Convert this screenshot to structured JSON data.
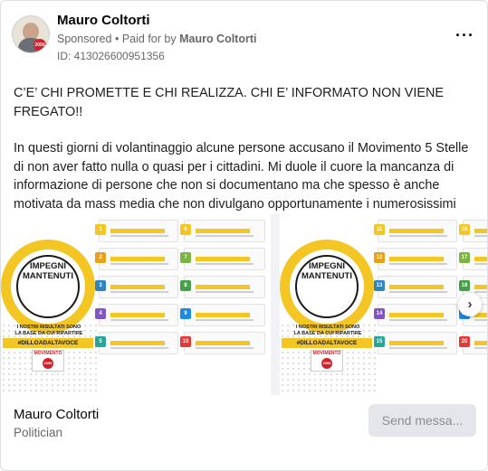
{
  "header": {
    "page_name": "Mauro Coltorti",
    "sponsored_label": "Sponsored",
    "separator": "•",
    "paid_for_prefix": "Paid for by",
    "paid_for_name": "Mauro Coltorti",
    "library_id": "ID: 413026600951356",
    "more_icon": "more-horizontal-icon",
    "avatar_badge": "2050"
  },
  "post": {
    "headline": "C’E’ CHI PROMETTE E CHI REALIZZA. CHI E’ INFORMATO NON VIENE FREGATO!!",
    "paragraph": "In questi giorni di volantinaggio alcune persone accusano il Movimento 5 Stelle di non aver fatto nulla o quasi per i cittadini. Mi duole il cuore la mancanza di informazione di persone che non si documentano ma che spesso è anche motivata da mass media che non divulgano opportunamente i numerosissimi provvedimenti utili al paese. Abbiamo avuto una delle legislature più complesse…"
  },
  "carousel": {
    "slides": [
      {
        "ring_title": "IMPEGNI\nMANTENUTI",
        "subtitle": "I NOSTRI RISULTATI SONO\nLA BASE DA CUI RIPARTIRE",
        "hashtag": "#DILLOADALTAVOCE",
        "logo_text": "MOVIMENTO",
        "logo_year": "2050",
        "numbers_left": [
          "1",
          "2",
          "3",
          "4",
          "5"
        ],
        "numbers_right": [
          "6",
          "7",
          "8",
          "9",
          "10"
        ]
      },
      {
        "ring_title": "IMPEGNI\nMANTENUTI",
        "subtitle": "I NOSTRI RISULTATI SONO\nLA BASE DA CUI RIPARTIRE",
        "hashtag": "#DILLOADALTAVOCE",
        "logo_text": "MOVIMENTO",
        "logo_year": "2050",
        "numbers_left": [
          "11",
          "12",
          "13",
          "14",
          "15"
        ],
        "numbers_right": [
          "16",
          "17",
          "18",
          "19",
          "20"
        ]
      }
    ],
    "next_icon": "chevron-right-icon",
    "next_glyph": "›",
    "row_colors": [
      "#f3c623",
      "#e8a21a",
      "#2e86c1",
      "#7e57c2",
      "#26a69a"
    ],
    "row_colors_right": [
      "#f3c623",
      "#7cb342",
      "#43a047",
      "#1e88e5",
      "#e53935"
    ]
  },
  "footer": {
    "page_name": "Mauro Coltorti",
    "category": "Politician",
    "cta_label": "Send messa..."
  }
}
